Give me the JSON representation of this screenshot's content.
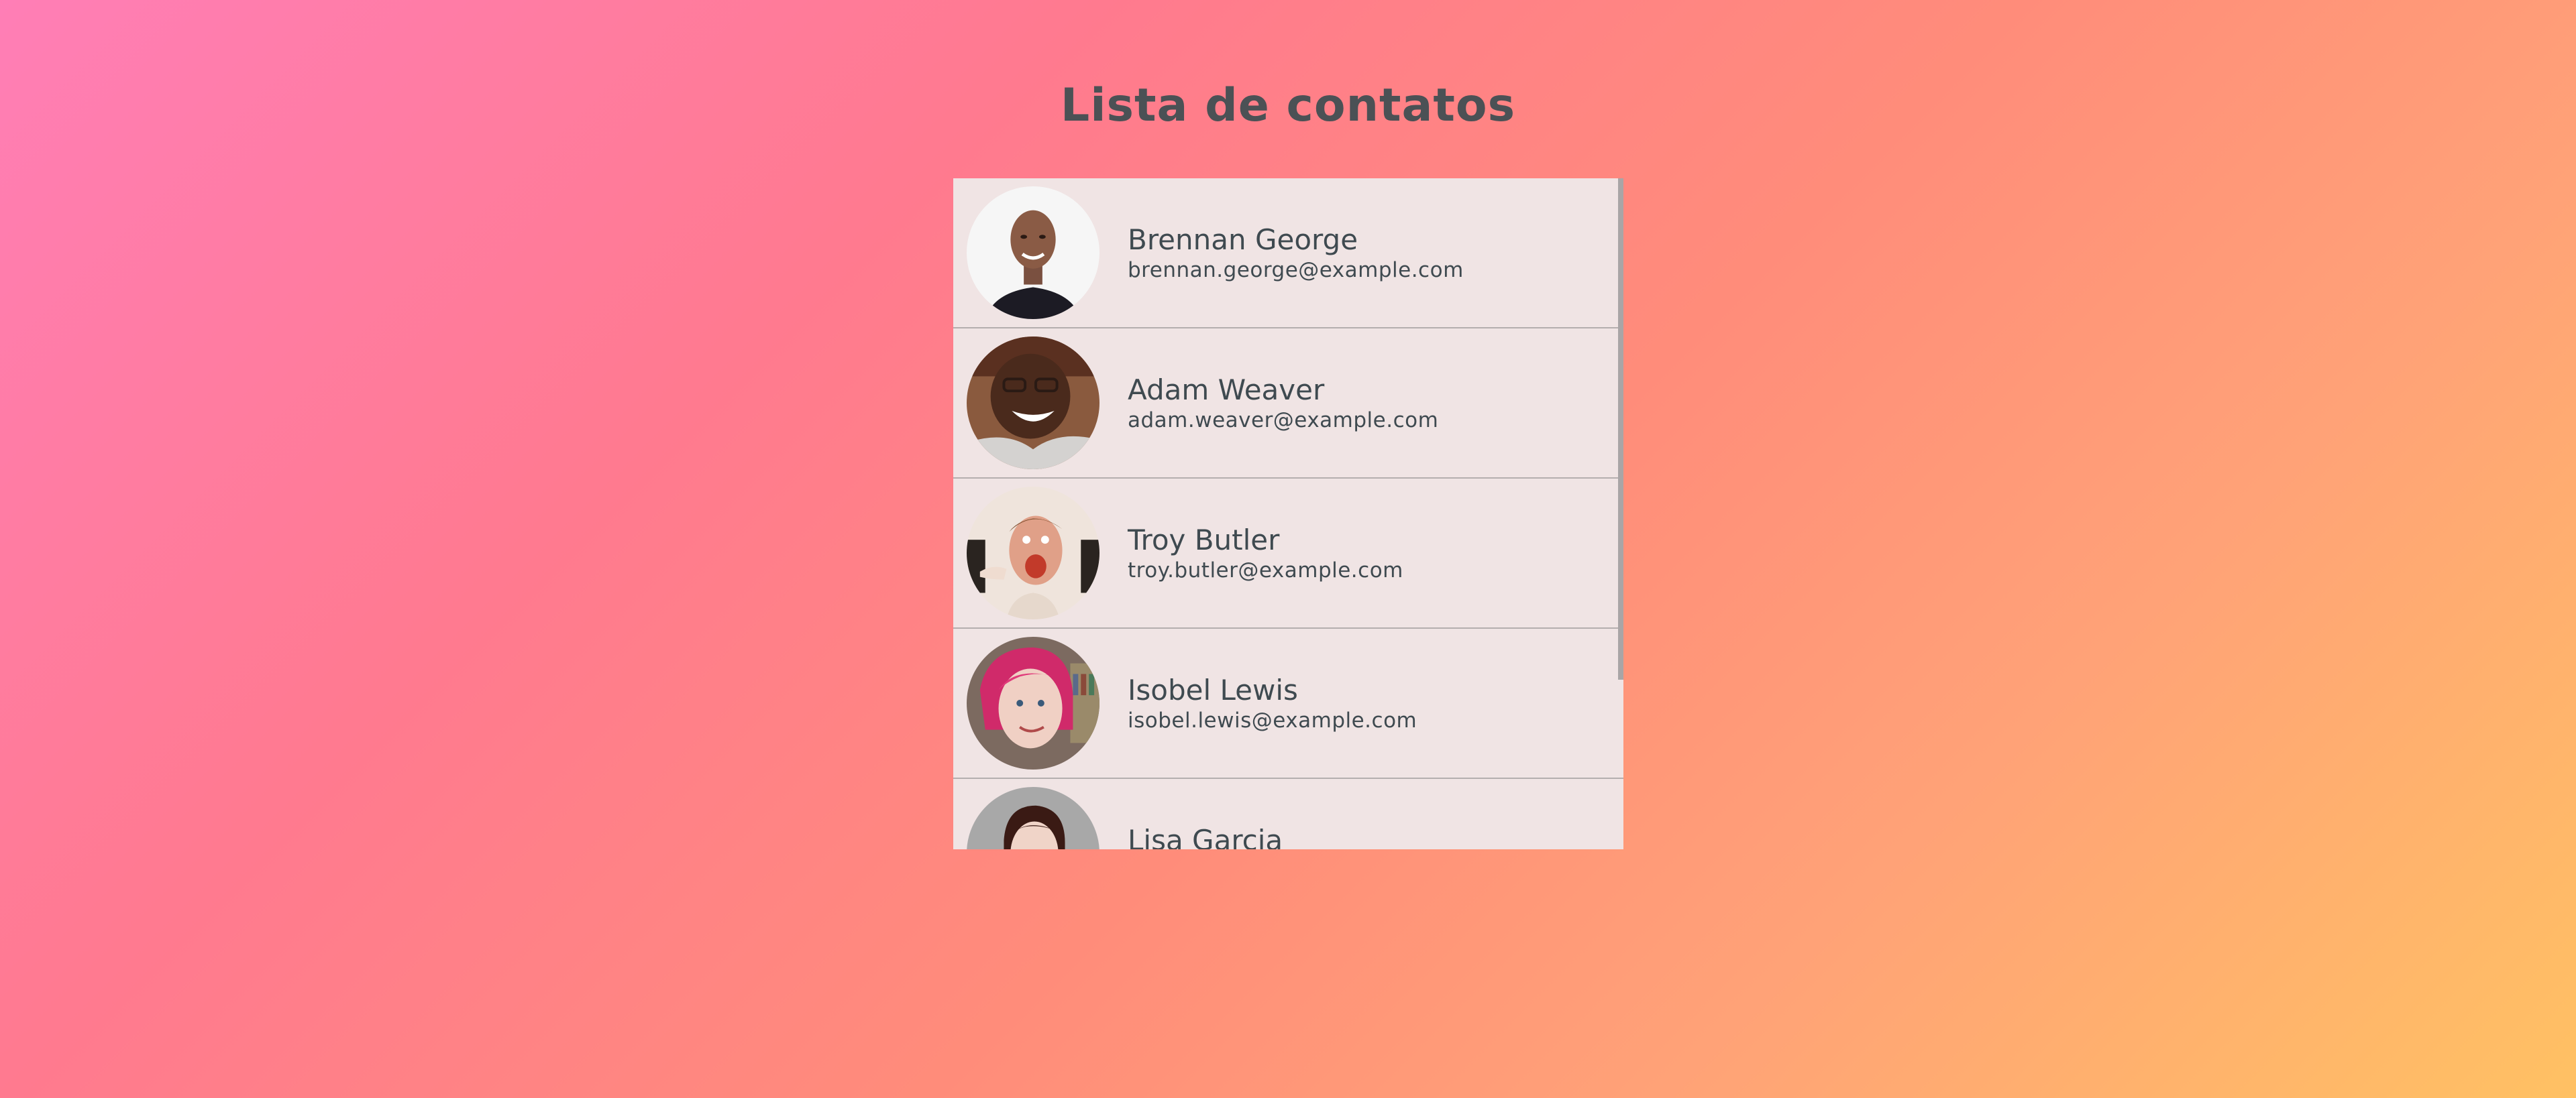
{
  "page": {
    "title": "Lista de contatos"
  },
  "contacts": [
    {
      "name": "Brennan George",
      "email": "brennan.george@example.com",
      "avatar": "photo-man-black-shirt"
    },
    {
      "name": "Adam Weaver",
      "email": "adam.weaver@example.com",
      "avatar": "photo-man-glasses"
    },
    {
      "name": "Troy Butler",
      "email": "troy.butler@example.com",
      "avatar": "photo-man-funny-face"
    },
    {
      "name": "Isobel Lewis",
      "email": "isobel.lewis@example.com",
      "avatar": "photo-woman-pink-hair"
    },
    {
      "name": "Lisa Garcia",
      "email": "",
      "avatar": "photo-woman-dark-hair"
    }
  ],
  "colors": {
    "gradient_start": "#ff7eb6",
    "gradient_end": "#ffc163",
    "list_background": "#f0e4e4",
    "text": "#3f4a50",
    "title": "#4b5155",
    "divider": "#b4aeae"
  }
}
